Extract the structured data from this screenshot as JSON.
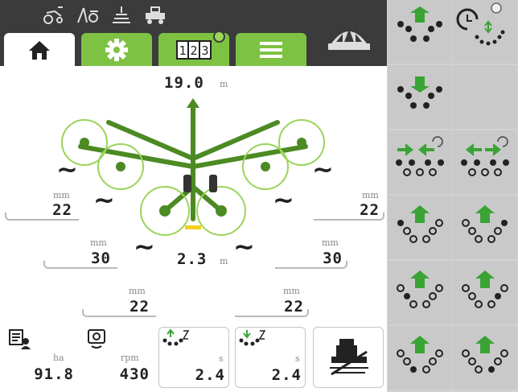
{
  "status_icons": [
    "tractor-tilt-icon",
    "tractor-rake-icon",
    "field-grid-icon",
    "hitch-icon"
  ],
  "tabs": [
    {
      "id": "home",
      "icon": "home-icon"
    },
    {
      "id": "settings",
      "icon": "gear-icon"
    },
    {
      "id": "counter",
      "icon": "counter-icon",
      "text": "123"
    },
    {
      "id": "menu",
      "icon": "menu-icon"
    }
  ],
  "main": {
    "working_width": {
      "value": "19.0",
      "unit": "m"
    },
    "swath_width": {
      "value": "2.3",
      "unit": "m"
    },
    "heights": {
      "outer_left": {
        "value": "22",
        "unit": "mm"
      },
      "outer_right": {
        "value": "22",
        "unit": "mm"
      },
      "mid_left": {
        "value": "30",
        "unit": "mm"
      },
      "mid_right": {
        "value": "30",
        "unit": "mm"
      },
      "inner_left": {
        "value": "22",
        "unit": "mm"
      },
      "inner_right": {
        "value": "22",
        "unit": "mm"
      }
    },
    "tilde": "~"
  },
  "bottom": {
    "area": {
      "value": "91.8",
      "unit": "ha"
    },
    "pto": {
      "value": "430",
      "unit": "rpm"
    },
    "lift_time": {
      "value": "2.4",
      "unit": "s"
    },
    "lower_time": {
      "value": "2.4",
      "unit": "s"
    }
  },
  "colors": {
    "accent": "#7dc242",
    "dark": "#3b3b3b",
    "panel": "#c9c9c9"
  }
}
